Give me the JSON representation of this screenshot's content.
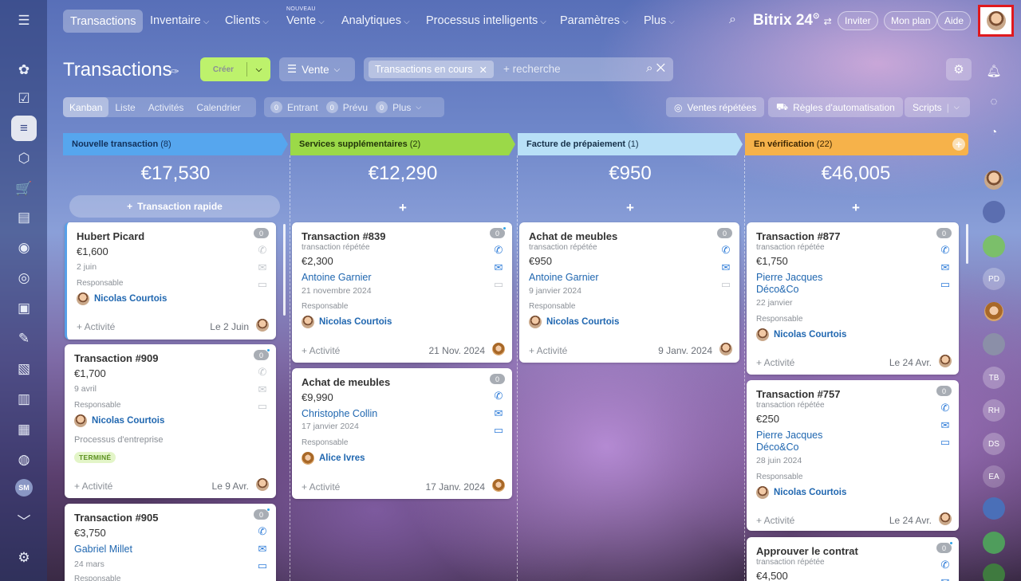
{
  "topnav": {
    "active": "Transactions",
    "items": [
      {
        "label": "Inventaire"
      },
      {
        "label": "Clients"
      },
      {
        "label": "Vente"
      },
      {
        "label": "Analytiques"
      },
      {
        "label": "Processus intelligents"
      },
      {
        "label": "Paramètres"
      },
      {
        "label": "Plus"
      }
    ],
    "new_badge": "NOUVEAU",
    "brand": "Bitrix 24",
    "invite": "Inviter",
    "plan": "Mon plan",
    "help": "Aide"
  },
  "sidebar": {
    "user_initials": "SM"
  },
  "rightbar": {
    "initials": [
      "PD",
      "TB",
      "RH",
      "DS",
      "EA"
    ]
  },
  "toolbar": {
    "title": "Transactions",
    "create_label": "Créer",
    "pipeline_label": "Vente",
    "filter_chip": "Transactions en cours",
    "search_placeholder": "+ recherche"
  },
  "views": {
    "tabs": [
      "Kanban",
      "Liste",
      "Activités",
      "Calendrier"
    ],
    "active": "Kanban",
    "counters": [
      {
        "count": "0",
        "label": "Entrant"
      },
      {
        "count": "0",
        "label": "Prévu"
      },
      {
        "count": "0",
        "label": "Plus"
      }
    ],
    "repeat_sales": "Ventes répétées",
    "automation": "Règles d'automatisation",
    "scripts": "Scripts"
  },
  "columns": [
    {
      "name": "Nouvelle transaction",
      "count": "(8)",
      "sum": "€17,530",
      "color": "#56a6ee",
      "text_color": "#12305a",
      "quick_add": "Transaction rapide"
    },
    {
      "name": "Services supplémentaires",
      "count": "(2)",
      "sum": "€12,290",
      "color": "#9bd948",
      "text_color": "#22360a"
    },
    {
      "name": "Facture de prépaiement",
      "count": "(1)",
      "sum": "€950",
      "color": "#b8e0f7",
      "text_color": "#163049"
    },
    {
      "name": "En vérification",
      "count": "(22)",
      "sum": "€46,005",
      "color": "#f6b24a",
      "text_color": "#3d2603"
    }
  ],
  "cards": {
    "c1": {
      "title": "Hubert Picard",
      "amount": "€1,600",
      "date": "2 juin",
      "resp_label": "Responsable",
      "resp": "Nicolas Courtois",
      "activity": "+ Activité",
      "deadline": "Le 2 Juin",
      "badge": "0"
    },
    "c2": {
      "title": "Transaction #909",
      "amount": "€1,700",
      "date": "9 avril",
      "resp_label": "Responsable",
      "resp": "Nicolas Courtois",
      "process": "Processus d'entreprise",
      "status": "TERMINÉ",
      "activity": "+ Activité",
      "deadline": "Le 9 Avr.",
      "badge": "0"
    },
    "c3": {
      "title": "Transaction #905",
      "amount": "€3,750",
      "client": "Gabriel Millet",
      "date": "24 mars",
      "resp_label": "Responsable",
      "badge": "0"
    },
    "c4": {
      "title": "Transaction #839",
      "sub": "transaction répétée",
      "amount": "€2,300",
      "client": "Antoine Garnier",
      "date": "21 novembre 2024",
      "resp_label": "Responsable",
      "resp": "Nicolas Courtois",
      "activity": "+ Activité",
      "deadline": "21 Nov. 2024",
      "badge": "0"
    },
    "c5": {
      "title": "Achat de meubles",
      "amount": "€9,990",
      "client": "Christophe Collin",
      "date": "17 janvier 2024",
      "resp_label": "Responsable",
      "resp": "Alice Ivres",
      "activity": "+ Activité",
      "deadline": "17 Janv. 2024",
      "badge": "0"
    },
    "c6": {
      "title": "Achat de meubles",
      "sub": "transaction répétée",
      "amount": "€950",
      "client": "Antoine Garnier",
      "date": "9 janvier 2024",
      "resp_label": "Responsable",
      "resp": "Nicolas Courtois",
      "activity": "+ Activité",
      "deadline": "9 Janv. 2024",
      "badge": "0"
    },
    "c7": {
      "title": "Transaction #877",
      "sub": "transaction répétée",
      "amount": "€1,750",
      "client": "Pierre Jacques",
      "company": "Déco&Co",
      "date": "22 janvier",
      "resp_label": "Responsable",
      "resp": "Nicolas Courtois",
      "activity": "+ Activité",
      "deadline": "Le 24 Avr.",
      "badge": "0"
    },
    "c8": {
      "title": "Transaction #757",
      "sub": "transaction répétée",
      "amount": "€250",
      "client": "Pierre Jacques",
      "company": "Déco&Co",
      "date": "28 juin 2024",
      "resp_label": "Responsable",
      "resp": "Nicolas Courtois",
      "activity": "+ Activité",
      "deadline": "Le 24 Avr.",
      "badge": "0"
    },
    "c9": {
      "title": "Approuver le contrat",
      "sub": "transaction répétée",
      "amount": "€4,500",
      "badge": "0"
    }
  }
}
